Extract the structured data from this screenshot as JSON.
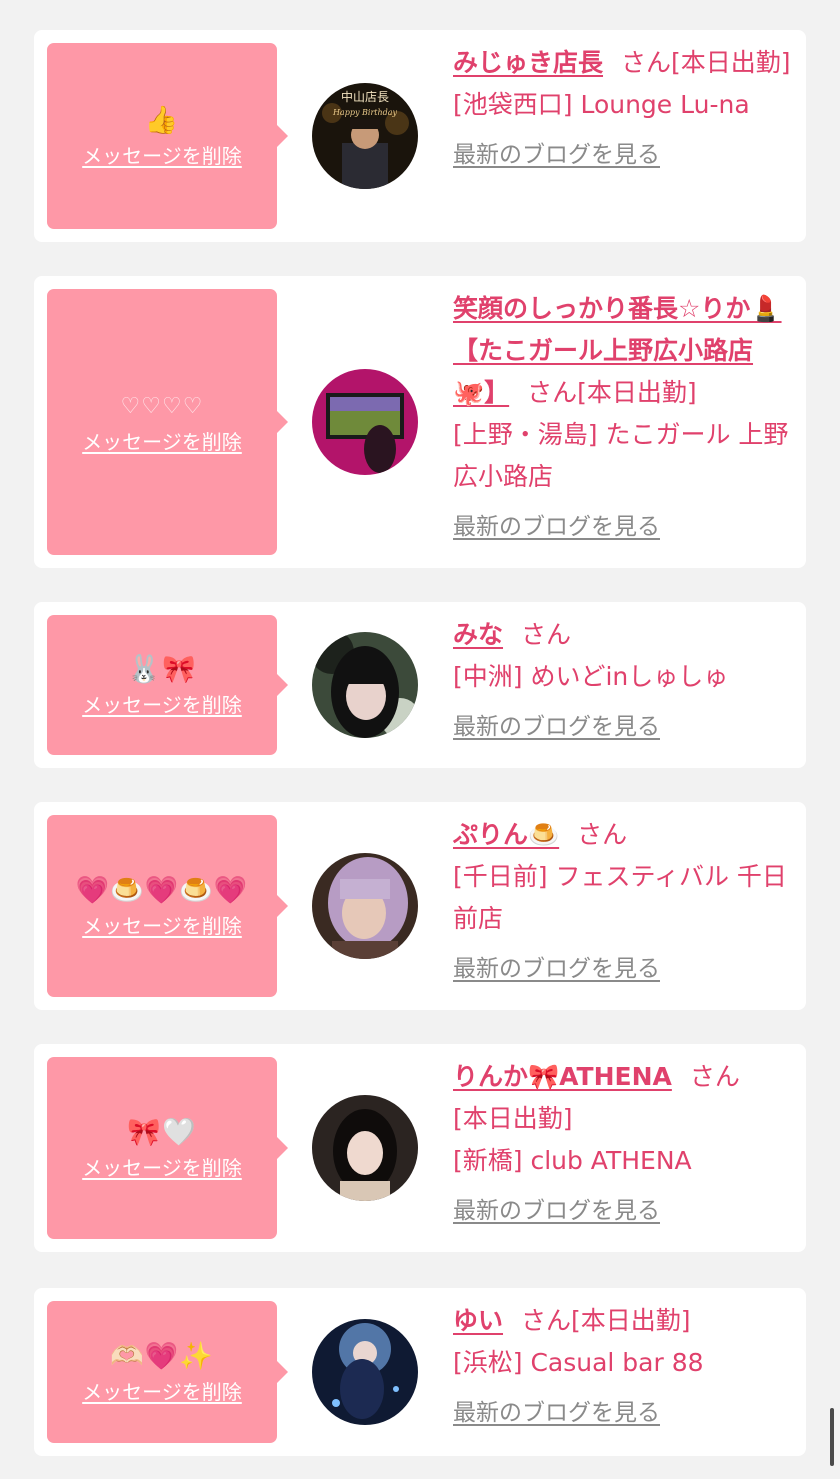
{
  "delete_label": "メッセージを削除",
  "blog_label": "最新のブログを見る",
  "san_label": "さん",
  "messages": [
    {
      "reaction": "👍",
      "name": "みじゅき店長",
      "status": "[本日出勤]",
      "shop": "[池袋西口] Lounge Lu-na"
    },
    {
      "reaction": "♡♡♡♡",
      "name": "笑顔のしっかり番長☆りか💄【たこガール上野広小路店🐙】",
      "status": "[本日出勤]",
      "shop": "[上野・湯島] たこガール 上野広小路店"
    },
    {
      "reaction": "🐰🎀",
      "name": "みな",
      "status": "",
      "shop": "[中洲] めいどinしゅしゅ"
    },
    {
      "reaction": "💗🍮💗🍮💗",
      "name": "ぷりん🍮",
      "status": "",
      "shop": "[千日前] フェスティバル 千日前店"
    },
    {
      "reaction": "🎀🤍",
      "name": "りんか🎀ATHENA",
      "status": "[本日出勤]",
      "shop": "[新橋] club ATHENA"
    },
    {
      "reaction": "🫶🏻💗✨",
      "name": "ゆい",
      "status": "[本日出勤]",
      "shop": "[浜松] Casual bar 88"
    }
  ],
  "avatar_overlay_text": {
    "title": "中山店長",
    "subtitle": "Happy Birthday"
  },
  "colors": {
    "background": "#f2f2f2",
    "bubble": "#fe98a7",
    "accent": "#e0416c",
    "blog_link": "#8a8a8a"
  }
}
